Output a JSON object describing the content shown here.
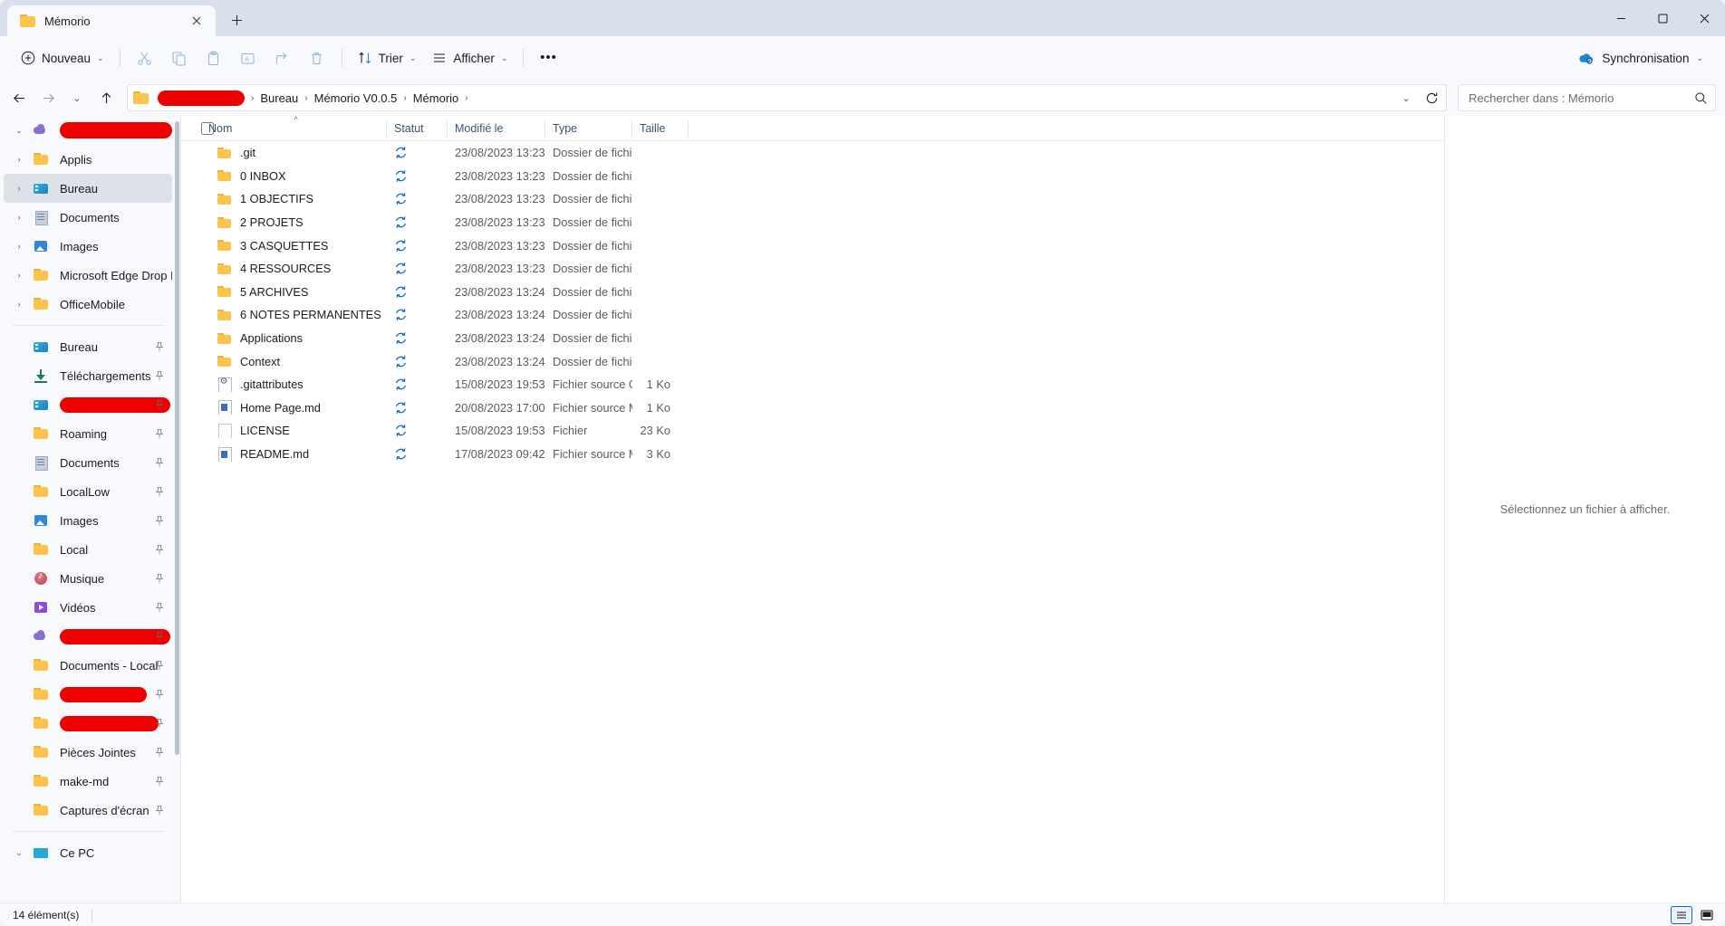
{
  "window": {
    "tab": {
      "title": "Mémorio",
      "close_icon": "close-icon",
      "folder_icon": "folder-icon"
    },
    "new_tab_icon": "plus-icon",
    "controls": {
      "minimize": "—",
      "maximize": "▢",
      "close": "✕"
    }
  },
  "commandbar": {
    "new_label": "Nouveau",
    "new_icon": "plus-circle-icon",
    "cut_icon": "scissors-icon",
    "copy_icon": "copy-icon",
    "paste_icon": "paste-icon",
    "rename_icon": "rename-icon",
    "share_icon": "share-icon",
    "delete_icon": "trash-icon",
    "sort_label": "Trier",
    "sort_icon": "sort-arrows-icon",
    "view_label": "Afficher",
    "view_icon": "hamburger-icon",
    "more_label": "•••",
    "sync_label": "Synchronisation",
    "sync_icon": "onedrive-cloud-icon"
  },
  "addressbar": {
    "back_icon": "arrow-left-icon",
    "forward_icon": "arrow-right-icon",
    "recent_icon": "chevron-down-icon",
    "up_icon": "arrow-up-icon",
    "folder_icon": "folder-icon",
    "redacted_segment": "",
    "crumbs": [
      "Bureau",
      "Mémorio V0.0.5",
      "Mémorio"
    ],
    "separator": "›",
    "dropdown_icon": "chevron-down-icon",
    "refresh_icon": "refresh-icon"
  },
  "search": {
    "placeholder": "Rechercher dans : Mémorio",
    "value": "",
    "icon": "search-icon"
  },
  "navpane": {
    "tree_root": {
      "label": "",
      "redacted": true,
      "twisty": "⌄",
      "icon": "onedrive-cloud-icon"
    },
    "tree_items": [
      {
        "label": "Applis",
        "icon": "folder-icon",
        "twisty": "›",
        "selected": false
      },
      {
        "label": "Bureau",
        "icon": "desktop-icon",
        "twisty": "›",
        "selected": true
      },
      {
        "label": "Documents",
        "icon": "documents-icon",
        "twisty": "›",
        "selected": false
      },
      {
        "label": "Images",
        "icon": "pictures-icon",
        "twisty": "›",
        "selected": false
      },
      {
        "label": "Microsoft Edge Drop Files",
        "icon": "folder-icon",
        "twisty": "›",
        "selected": false
      },
      {
        "label": "OfficeMobile",
        "icon": "folder-icon",
        "twisty": "›",
        "selected": false
      }
    ],
    "pinned_items": [
      {
        "label": "Bureau",
        "icon": "desktop-icon",
        "pinned": true,
        "redacted": false
      },
      {
        "label": "Téléchargements",
        "icon": "download-icon",
        "pinned": true,
        "redacted": false
      },
      {
        "label": "",
        "icon": "desktop-icon",
        "pinned": true,
        "redacted": true
      },
      {
        "label": "Roaming",
        "icon": "folder-icon",
        "pinned": true,
        "redacted": false
      },
      {
        "label": "Documents",
        "icon": "documents-icon",
        "pinned": true,
        "redacted": false
      },
      {
        "label": "LocalLow",
        "icon": "folder-icon",
        "pinned": true,
        "redacted": false
      },
      {
        "label": "Images",
        "icon": "pictures-icon",
        "pinned": true,
        "redacted": false
      },
      {
        "label": "Local",
        "icon": "folder-icon",
        "pinned": true,
        "redacted": false
      },
      {
        "label": "Musique",
        "icon": "music-icon",
        "pinned": true,
        "redacted": false
      },
      {
        "label": "Vidéos",
        "icon": "video-icon",
        "pinned": true,
        "redacted": false
      },
      {
        "label": "",
        "icon": "onedrive-cloud-icon",
        "pinned": true,
        "redacted": true
      },
      {
        "label": "Documents - Local",
        "icon": "folder-icon",
        "pinned": true,
        "redacted": false
      },
      {
        "label": "",
        "icon": "folder-icon",
        "pinned": true,
        "redacted": true
      },
      {
        "label": "",
        "icon": "folder-icon",
        "pinned": true,
        "redacted": true
      },
      {
        "label": "Pièces Jointes",
        "icon": "folder-icon",
        "pinned": true,
        "redacted": false
      },
      {
        "label": "make-md",
        "icon": "folder-icon",
        "pinned": true,
        "redacted": false
      },
      {
        "label": "Captures d'écran",
        "icon": "folder-icon",
        "pinned": true,
        "redacted": false
      }
    ],
    "bottom_item": {
      "label": "Ce PC",
      "icon": "pc-icon",
      "twisty": "⌄"
    }
  },
  "filelist": {
    "columns": [
      {
        "key": "name",
        "label": "Nom",
        "sorted": true,
        "sort_arrow": "^"
      },
      {
        "key": "status",
        "label": "Statut",
        "sorted": false
      },
      {
        "key": "modified",
        "label": "Modifié le",
        "sorted": false
      },
      {
        "key": "type",
        "label": "Type",
        "sorted": false
      },
      {
        "key": "size",
        "label": "Taille",
        "sorted": false
      }
    ],
    "select_all_checkbox": false,
    "rows": [
      {
        "name": ".git",
        "icon": "folder-icon",
        "status": "sync-icon",
        "modified": "23/08/2023 13:23",
        "type": "Dossier de fichiers",
        "size": ""
      },
      {
        "name": "0 INBOX",
        "icon": "folder-icon",
        "status": "sync-icon",
        "modified": "23/08/2023 13:23",
        "type": "Dossier de fichiers",
        "size": ""
      },
      {
        "name": "1 OBJECTIFS",
        "icon": "folder-icon",
        "status": "sync-icon",
        "modified": "23/08/2023 13:23",
        "type": "Dossier de fichiers",
        "size": ""
      },
      {
        "name": "2 PROJETS",
        "icon": "folder-icon",
        "status": "sync-icon",
        "modified": "23/08/2023 13:23",
        "type": "Dossier de fichiers",
        "size": ""
      },
      {
        "name": "3 CASQUETTES",
        "icon": "folder-icon",
        "status": "sync-icon",
        "modified": "23/08/2023 13:23",
        "type": "Dossier de fichiers",
        "size": ""
      },
      {
        "name": "4 RESSOURCES",
        "icon": "folder-icon",
        "status": "sync-icon",
        "modified": "23/08/2023 13:23",
        "type": "Dossier de fichiers",
        "size": ""
      },
      {
        "name": "5 ARCHIVES",
        "icon": "folder-icon",
        "status": "sync-icon",
        "modified": "23/08/2023 13:24",
        "type": "Dossier de fichiers",
        "size": ""
      },
      {
        "name": "6 NOTES PERMANENTES",
        "icon": "folder-icon",
        "status": "sync-icon",
        "modified": "23/08/2023 13:24",
        "type": "Dossier de fichiers",
        "size": ""
      },
      {
        "name": "Applications",
        "icon": "folder-icon",
        "status": "sync-icon",
        "modified": "23/08/2023 13:24",
        "type": "Dossier de fichiers",
        "size": ""
      },
      {
        "name": "Context",
        "icon": "folder-icon",
        "status": "sync-icon",
        "modified": "23/08/2023 13:24",
        "type": "Dossier de fichiers",
        "size": ""
      },
      {
        "name": ".gitattributes",
        "icon": "gear-file-icon",
        "status": "sync-icon",
        "modified": "15/08/2023 19:53",
        "type": "Fichier source Git ...",
        "size": "1 Ko"
      },
      {
        "name": "Home Page.md",
        "icon": "markdown-file-icon",
        "status": "sync-icon",
        "modified": "20/08/2023 17:00",
        "type": "Fichier source Mar...",
        "size": "1 Ko"
      },
      {
        "name": "LICENSE",
        "icon": "blank-file-icon",
        "status": "sync-icon",
        "modified": "15/08/2023 19:53",
        "type": "Fichier",
        "size": "23 Ko"
      },
      {
        "name": "README.md",
        "icon": "markdown-file-icon",
        "status": "sync-icon",
        "modified": "17/08/2023 09:42",
        "type": "Fichier source Mar...",
        "size": "3 Ko"
      }
    ]
  },
  "preview": {
    "message": "Sélectionnez un fichier à afficher."
  },
  "statusbar": {
    "item_count": "14 élément(s)",
    "details_view_icon": "details-view-icon",
    "large_icons_view_icon": "large-icons-view-icon",
    "active_view": "details"
  },
  "colors": {
    "accent": "#1668c7",
    "titlebar_bg": "#d9dfec",
    "chrome_bg": "#f7f9fc",
    "content_bg": "#ffffff",
    "redaction": "#ee0000",
    "folder_yellow": "#fbc54b",
    "header_text": "#3b5270"
  }
}
